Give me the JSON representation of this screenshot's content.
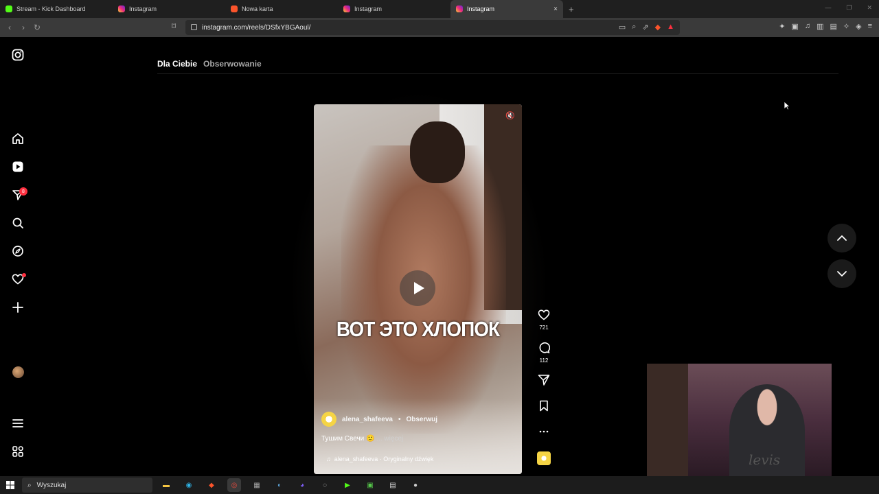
{
  "browser": {
    "tabs": [
      {
        "title": "Stream - Kick Dashboard",
        "favicon_color": "#53fc18",
        "active": false
      },
      {
        "title": "Instagram",
        "favicon_color": "#e1306c",
        "active": false
      },
      {
        "title": "Nowa karta",
        "favicon_color": "#fb542b",
        "active": false
      },
      {
        "title": "Instagram",
        "favicon_color": "#e1306c",
        "active": false
      },
      {
        "title": "Instagram",
        "favicon_color": "#e1306c",
        "active": true
      }
    ],
    "new_tab_symbol": "+",
    "close_symbol": "×",
    "url": "instagram.com/reels/DSfxYBGAoul/"
  },
  "instagram": {
    "feed_tabs": {
      "for_you": "Dla Ciebie",
      "following": "Obserwowanie"
    },
    "notification_count": "8",
    "reel": {
      "overlay_text": "ВОТ ЭТО ХЛОПОК",
      "author": "alena_shafeeva",
      "separator": "•",
      "follow_label": "Obserwuj",
      "caption": "Тушим Свечи 🙂",
      "more_label": "... więcej",
      "audio": "alena_shafeeva · Oryginalny dźwięk",
      "likes": "721",
      "comments": "112"
    }
  },
  "taskbar": {
    "search_placeholder": "Wyszukaj"
  },
  "colors": {
    "accent_red": "#ff3040",
    "background": "#000000"
  }
}
